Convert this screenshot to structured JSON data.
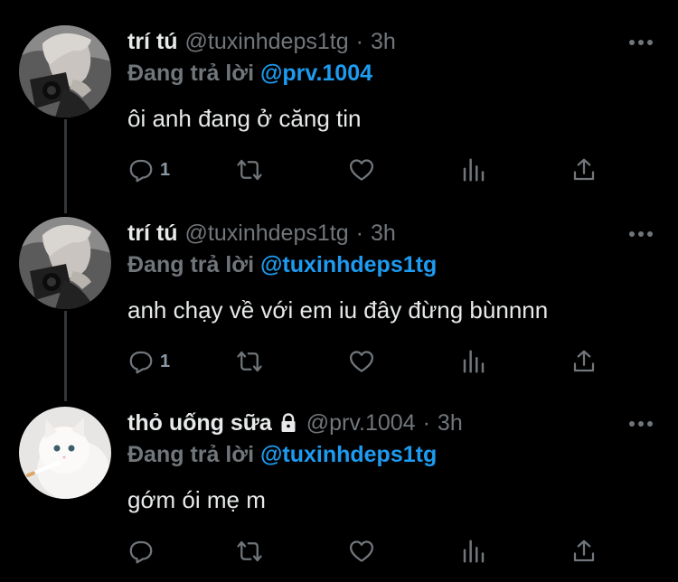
{
  "tweets": [
    {
      "display_name": "trí tú",
      "handle": "@tuxinhdeps1tg",
      "separator": "·",
      "time": "3h",
      "reply_prefix": "Đang trả lời",
      "reply_to": "@prv.1004",
      "text": "ôi anh đang ở căng tin",
      "reply_count": "1",
      "avatar": "boy-with-camera-avatar",
      "locked": false
    },
    {
      "display_name": "trí tú",
      "handle": "@tuxinhdeps1tg",
      "separator": "·",
      "time": "3h",
      "reply_prefix": "Đang trả lời",
      "reply_to": "@tuxinhdeps1tg",
      "text": "anh chạy về với em iu đây đừng bùnnnn",
      "reply_count": "1",
      "avatar": "boy-with-camera-avatar",
      "locked": false
    },
    {
      "display_name": "thỏ uống sữa",
      "handle": "@prv.1004",
      "separator": "·",
      "time": "3h",
      "reply_prefix": "Đang trả lời",
      "reply_to": "@tuxinhdeps1tg",
      "text": "gớm ói mẹ m",
      "reply_count": "",
      "avatar": "white-cat-avatar",
      "locked": true
    }
  ],
  "icons": {
    "reply": "reply-icon",
    "retweet": "retweet-icon",
    "like": "heart-icon",
    "analytics": "analytics-icon",
    "share": "share-icon",
    "more": "more-icon",
    "lock": "lock-icon"
  },
  "colors": {
    "background": "#000000",
    "primary_text": "#e7e9ea",
    "secondary_text": "#71767b",
    "mention": "#1d9bf0",
    "thread_line": "#333639"
  }
}
